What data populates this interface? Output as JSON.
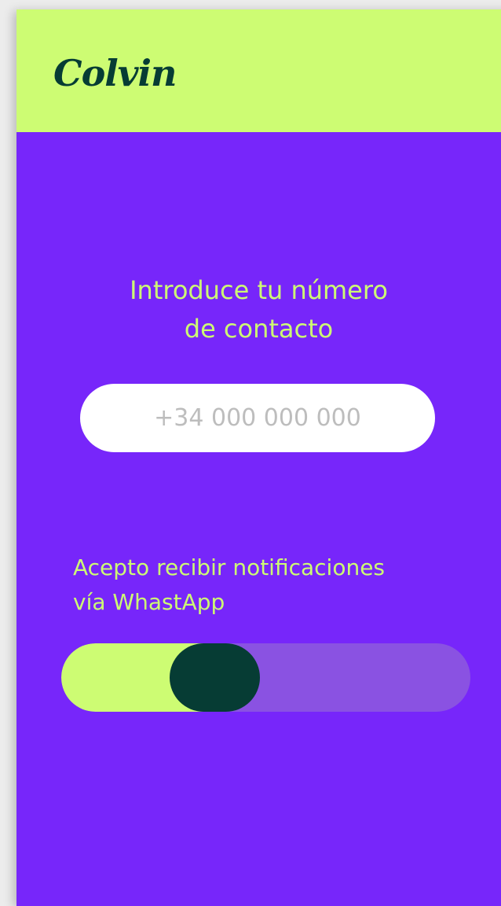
{
  "app": {
    "logo_text": "Colvin"
  },
  "form": {
    "title_line1": "Introduce tu número",
    "title_line2": "de contacto",
    "phone_placeholder": "+34 000 000 000",
    "phone_value": ""
  },
  "consent": {
    "label_line1": "Acepto recibir notificaciones",
    "label_line2": "vía WhastApp",
    "toggle_level": 0.34
  },
  "colors": {
    "header_background": "#cdfc73",
    "page_background": "#7726fa",
    "accent_text": "#cdfc73",
    "logo": "#063c34",
    "toggle_track": "#8a52e2",
    "toggle_knob": "#063c34"
  }
}
